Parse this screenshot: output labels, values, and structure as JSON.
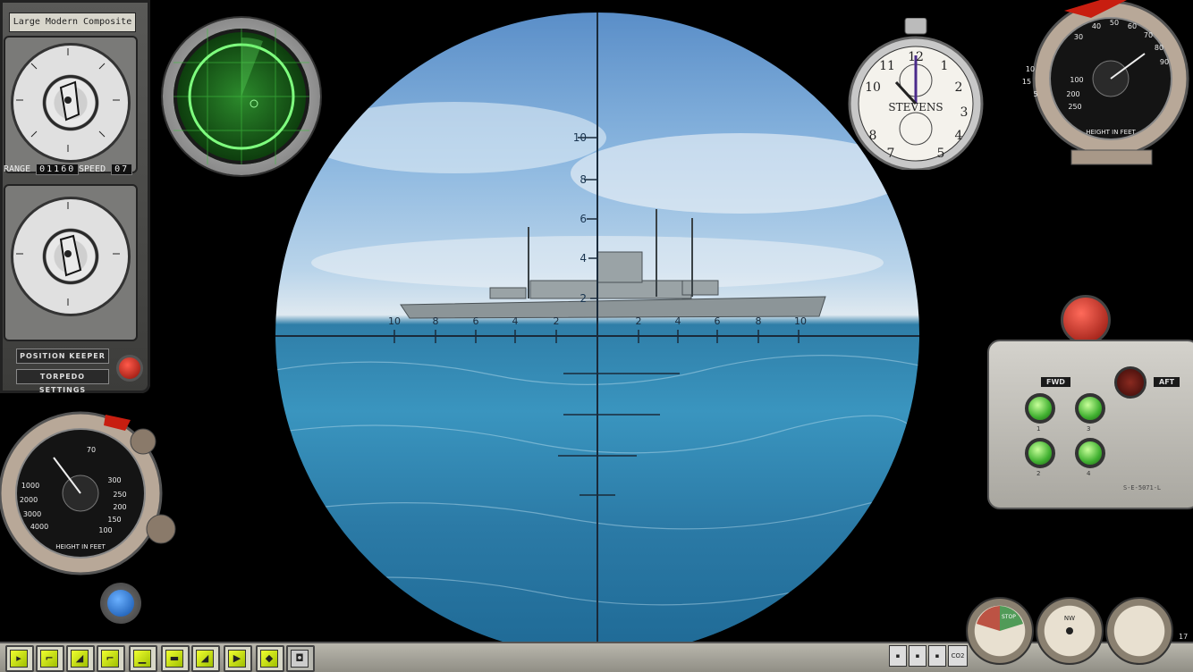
{
  "tdc": {
    "plate_label": "Large Modern Composite",
    "range_label": "RANGE",
    "range_value": "01160",
    "speed_label": "SPEED",
    "speed_value": "07",
    "position_keeper_label": "POSITION KEEPER",
    "torpedo_settings_label": "TORPEDO SETTINGS"
  },
  "stopwatch": {
    "brand": "STEVENS",
    "hour_numbers": [
      "11",
      "12",
      "1",
      "2",
      "3",
      "4",
      "5",
      "7",
      "8",
      "10"
    ]
  },
  "depth_gauge": {
    "label": "HEIGHT IN FEET",
    "scale_numbers": [
      "30",
      "40",
      "50",
      "60",
      "70",
      "80",
      "90",
      "100",
      "200",
      "250",
      "15",
      "5",
      "10"
    ]
  },
  "left_gauge": {
    "label": "HEIGHT IN FEET",
    "scale_numbers": [
      "2000",
      "3000",
      "4000",
      "1000",
      "300",
      "250",
      "200",
      "150",
      "100",
      "70"
    ]
  },
  "reticle": {
    "vertical_marks": [
      "10",
      "8",
      "6",
      "4",
      "2"
    ],
    "horizontal_marks_left": [
      "10",
      "8",
      "6",
      "4",
      "2"
    ],
    "horizontal_marks_right": [
      "2",
      "4",
      "6",
      "8",
      "10"
    ]
  },
  "torpedo_panel": {
    "fwd_label": "FWD",
    "aft_label": "AFT",
    "tube_numbers": [
      "1",
      "3",
      "2",
      "4"
    ],
    "serial": "S-E-5071-L"
  },
  "bottom_gauges": {
    "labels": [
      "STOP",
      "NW"
    ],
    "right_edge_text": "17"
  },
  "toolbar": {
    "status_tiles": [
      "CO2"
    ]
  },
  "colors": {
    "radar_green": "#2c8a2c",
    "tube_light_green": "#40b030",
    "alert_red": "#c81e10",
    "water_blue": "#2f7ea8",
    "sky_blue": "#8ab6df"
  }
}
